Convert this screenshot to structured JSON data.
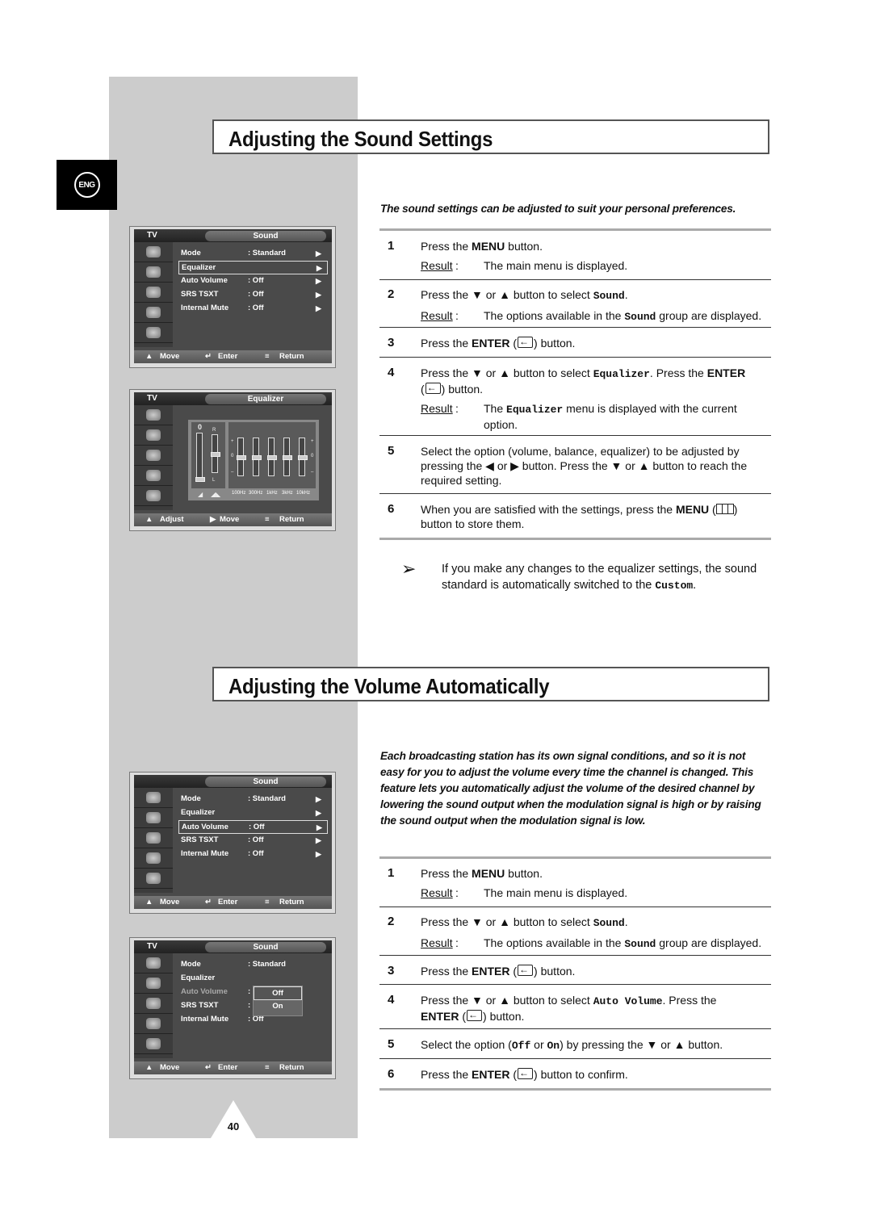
{
  "page": {
    "number": "40",
    "language_badge": "ENG"
  },
  "section1": {
    "title": "Adjusting the Sound Settings",
    "intro": "The sound settings can be adjusted to suit your personal preferences.",
    "steps": [
      {
        "num": "1",
        "pre": "Press the ",
        "bold": "MENU",
        "post": " button.",
        "result": "The main menu is displayed."
      },
      {
        "num": "2",
        "pre": "Press the ▼ or ▲ button to select ",
        "mono": "Sound",
        "post": ".",
        "result_pre": "The options available in the ",
        "result_mono": "Sound",
        "result_post": " group are displayed."
      },
      {
        "num": "3",
        "pre": "Press the ",
        "bold": "ENTER",
        "post": " button."
      },
      {
        "num": "4",
        "pre": "Press the ▼ or ▲ button to select ",
        "mono": "Equalizer",
        "mid": ". Press the ",
        "bold": "ENTER",
        "post": " button.",
        "result_pre": "The ",
        "result_mono": "Equalizer",
        "result_post": " menu is displayed with the current option."
      },
      {
        "num": "5",
        "text": "Select the option (volume, balance, equalizer) to be adjusted by pressing the ◀ or ▶ button. Press the ▼ or ▲ button to reach the required setting."
      },
      {
        "num": "6",
        "pre": "When you are satisfied with the settings, press the ",
        "bold": "MENU",
        "post": " button to store them."
      }
    ],
    "result_label": "Result",
    "note_pre": "If you make any changes to the equalizer settings, the sound standard is automatically switched to the ",
    "note_mono": "Custom",
    "note_post": "."
  },
  "section2": {
    "title": "Adjusting the Volume Automatically",
    "intro": "Each broadcasting station has its own signal conditions, and so it is not easy for you to adjust the volume every time the channel is changed. This feature lets you automatically adjust the volume of the desired channel by lowering the sound output when the modulation signal is high or by raising the sound output when the modulation signal is low.",
    "steps": [
      {
        "num": "1",
        "pre": "Press the ",
        "bold": "MENU",
        "post": " button.",
        "result": "The main menu is displayed."
      },
      {
        "num": "2",
        "pre": "Press the ▼ or ▲ button to select ",
        "mono": "Sound",
        "post": ".",
        "result_pre": "The options available in the ",
        "result_mono": "Sound",
        "result_post": " group are displayed."
      },
      {
        "num": "3",
        "pre": "Press the ",
        "bold": "ENTER",
        "post": " button."
      },
      {
        "num": "4",
        "pre": "Press the ▼ or ▲ button to select ",
        "mono": "Auto Volume",
        "mid": ". Press the ",
        "bold": "ENTER",
        "post": " button."
      },
      {
        "num": "5",
        "pre": "Select the option (",
        "mono1": "Off",
        "mid": " or ",
        "mono2": "On",
        "post": ") by pressing the ▼ or ▲ button."
      },
      {
        "num": "6",
        "pre": "Press the ",
        "bold": "ENTER",
        "post": " button to confirm."
      }
    ]
  },
  "screens": {
    "sound1": {
      "tv": "TV",
      "title": "Sound",
      "selected": "Equalizer",
      "items": [
        {
          "label": "Mode",
          "value": ": Standard"
        },
        {
          "label": "Equalizer",
          "value": ""
        },
        {
          "label": "Auto Volume",
          "value": ": Off"
        },
        {
          "label": "SRS TSXT",
          "value": ": Off"
        },
        {
          "label": "Internal Mute",
          "value": ": Off"
        }
      ],
      "footer": [
        "Move",
        "Enter",
        "Return"
      ]
    },
    "equalizer": {
      "tv": "TV",
      "title": "Equalizer",
      "volume": "0",
      "balance_top": "R",
      "balance_bottom": "L",
      "bands": [
        "100Hz",
        "300Hz",
        "1kHz",
        "3kHz",
        "10kHz"
      ],
      "band_levels": [
        0,
        0,
        0,
        0,
        0
      ],
      "balance_level": 0,
      "volume_level": 0,
      "plus": "+",
      "zero": "0",
      "minus": "–",
      "footer": [
        "Adjust",
        "Move",
        "Return"
      ]
    },
    "sound2": {
      "tv": "",
      "title": "Sound",
      "selected": "Auto Volume",
      "items": [
        {
          "label": "Mode",
          "value": ": Standard"
        },
        {
          "label": "Equalizer",
          "value": ""
        },
        {
          "label": "Auto Volume",
          "value": ": Off"
        },
        {
          "label": "SRS TSXT",
          "value": ": Off"
        },
        {
          "label": "Internal Mute",
          "value": ": Off"
        }
      ],
      "footer": [
        "Move",
        "Enter",
        "Return"
      ]
    },
    "sound3": {
      "tv": "TV",
      "title": "Sound",
      "items": [
        {
          "label": "Mode",
          "value": ": Standard"
        },
        {
          "label": "Equalizer",
          "value": ""
        },
        {
          "label": "Auto Volume",
          "value": ":"
        },
        {
          "label": "SRS TSXT",
          "value": ":"
        },
        {
          "label": "Internal Mute",
          "value": ": Off"
        }
      ],
      "popup": [
        "Off",
        "On"
      ],
      "popup_selected": "Off",
      "footer": [
        "Move",
        "Enter",
        "Return"
      ]
    }
  }
}
